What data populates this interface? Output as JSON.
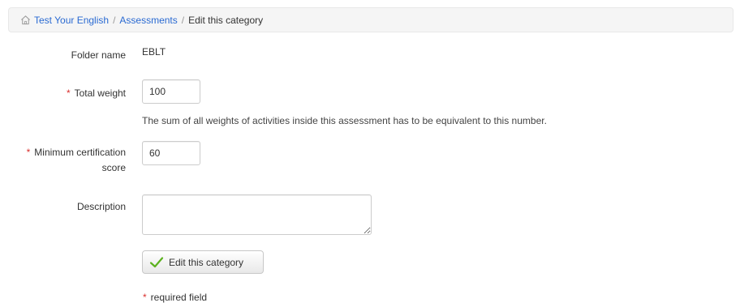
{
  "breadcrumb": {
    "items": [
      "Test Your English",
      "Assessments"
    ],
    "separator": "/",
    "current": "Edit this category"
  },
  "form": {
    "folder_name_label": "Folder name",
    "folder_name_value": "EBLT",
    "total_weight_label": "Total weight",
    "total_weight_value": "100",
    "total_weight_help": "The sum of all weights of activities inside this assessment has to be equivalent to this number.",
    "min_score_label_line1": "Minimum certification",
    "min_score_label_line2": "score",
    "min_score_value": "60",
    "description_label": "Description",
    "description_value": "",
    "submit_label": "Edit this category",
    "required_star": "*",
    "required_note": "required field"
  },
  "colors": {
    "link": "#2a6ad2",
    "required": "#d9302e",
    "check": "#5cb21f"
  },
  "icons": {
    "home": "home-icon",
    "check": "check-icon"
  }
}
